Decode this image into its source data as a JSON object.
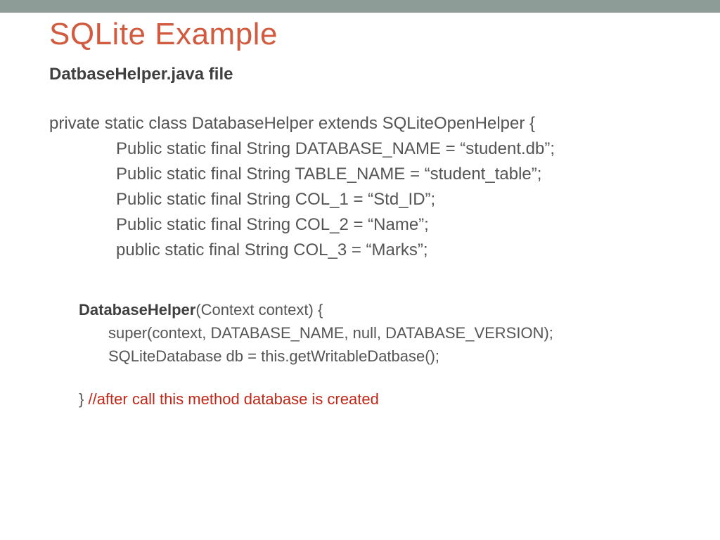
{
  "title": "SQLite Example",
  "subtitle": "DatbaseHelper.java file",
  "code": {
    "line1": "private static class DatabaseHelper extends SQLiteOpenHelper {",
    "line2": "Public static final String DATABASE_NAME = “student.db”;",
    "line3": "Public static final String TABLE_NAME = “student_table”;",
    "line4": "Public static final String COL_1 = “Std_ID”;",
    "line5": "Public static final String COL_2 = “Name”;",
    "line6": "public static final String COL_3 = “Marks”;"
  },
  "ctor": {
    "name": "DatabaseHelper",
    "sig": "(Context context) {",
    "body1": "super(context, DATABASE_NAME, null, DATABASE_VERSION);",
    "body2": "SQLiteDatabase db = this.getWritableDatbase();",
    "close": "}",
    "comment": "  //after call this method database is created"
  }
}
